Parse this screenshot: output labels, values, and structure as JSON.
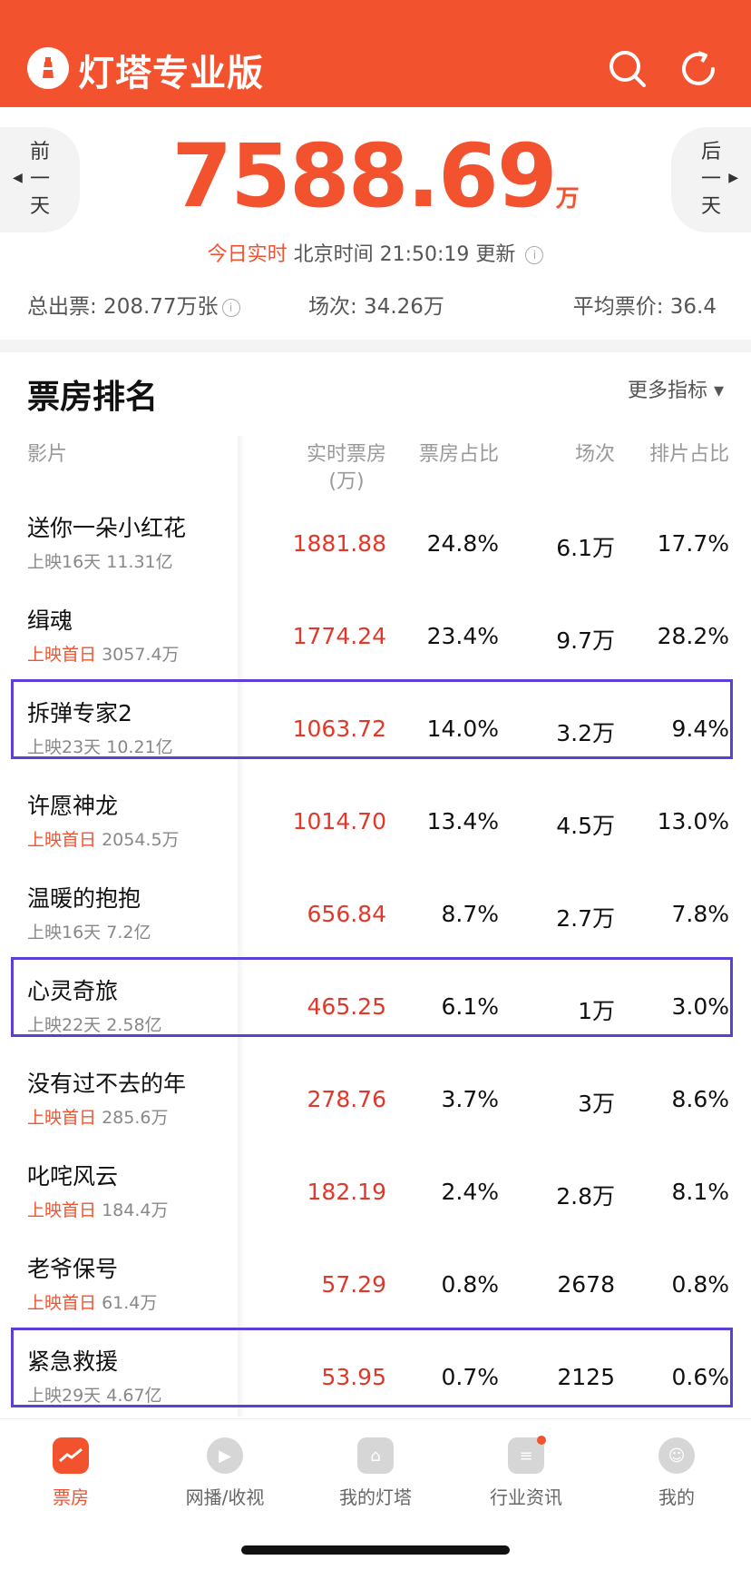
{
  "header": {
    "title": "灯塔专业版"
  },
  "summary": {
    "prev_day": [
      "前",
      "一",
      "天"
    ],
    "next_day": [
      "后",
      "一",
      "天"
    ],
    "total_value": "7588.69",
    "total_unit": "万",
    "realtime_label": "今日实时",
    "update_text": "北京时间 21:50:19 更新",
    "stats": {
      "tickets": "总出票: 208.77万张",
      "screenings": "场次: 34.26万",
      "avg_price": "平均票价: 36.4"
    }
  },
  "ranking": {
    "title": "票房排名",
    "more_metrics": "更多指标 ▾",
    "columns": {
      "film": "影片",
      "realtime_box_office": "实时票房",
      "realtime_unit": "(万)",
      "share": "票房占比",
      "screenings": "场次",
      "schedule_share": "排片占比"
    },
    "rows": [
      {
        "name": "送你一朵小红花",
        "tag": "",
        "days": "上映16天",
        "total": "11.31亿",
        "box": "1881.88",
        "share": "24.8%",
        "screenings": "6.1万",
        "schedule": "17.7%",
        "highlight": false
      },
      {
        "name": "缉魂",
        "tag": "上映首日",
        "days": "",
        "total": "3057.4万",
        "box": "1774.24",
        "share": "23.4%",
        "screenings": "9.7万",
        "schedule": "28.2%",
        "highlight": false
      },
      {
        "name": "拆弹专家2",
        "tag": "",
        "days": "上映23天",
        "total": "10.21亿",
        "box": "1063.72",
        "share": "14.0%",
        "screenings": "3.2万",
        "schedule": "9.4%",
        "highlight": true
      },
      {
        "name": "许愿神龙",
        "tag": "上映首日",
        "days": "",
        "total": "2054.5万",
        "box": "1014.70",
        "share": "13.4%",
        "screenings": "4.5万",
        "schedule": "13.0%",
        "highlight": false
      },
      {
        "name": "温暖的抱抱",
        "tag": "",
        "days": "上映16天",
        "total": "7.2亿",
        "box": "656.84",
        "share": "8.7%",
        "screenings": "2.7万",
        "schedule": "7.8%",
        "highlight": false
      },
      {
        "name": "心灵奇旅",
        "tag": "",
        "days": "上映22天",
        "total": "2.58亿",
        "box": "465.25",
        "share": "6.1%",
        "screenings": "1万",
        "schedule": "3.0%",
        "highlight": true
      },
      {
        "name": "没有过不去的年",
        "tag": "上映首日",
        "days": "",
        "total": "285.6万",
        "box": "278.76",
        "share": "3.7%",
        "screenings": "3万",
        "schedule": "8.6%",
        "highlight": false
      },
      {
        "name": "叱咤风云",
        "tag": "上映首日",
        "days": "",
        "total": "184.4万",
        "box": "182.19",
        "share": "2.4%",
        "screenings": "2.8万",
        "schedule": "8.1%",
        "highlight": false
      },
      {
        "name": "老爷保号",
        "tag": "上映首日",
        "days": "",
        "total": "61.4万",
        "box": "57.29",
        "share": "0.8%",
        "screenings": "2678",
        "schedule": "0.8%",
        "highlight": false
      },
      {
        "name": "紧急救援",
        "tag": "",
        "days": "上映29天",
        "total": "4.67亿",
        "box": "53.95",
        "share": "0.7%",
        "screenings": "2125",
        "schedule": "0.6%",
        "highlight": true
      }
    ]
  },
  "tabs": [
    {
      "label": "票房",
      "icon": "box-office-icon",
      "active": true
    },
    {
      "label": "网播/收视",
      "icon": "play-icon",
      "active": false
    },
    {
      "label": "我的灯塔",
      "icon": "lighthouse-icon",
      "active": false
    },
    {
      "label": "行业资讯",
      "icon": "news-icon",
      "active": false
    },
    {
      "label": "我的",
      "icon": "user-icon",
      "active": false
    }
  ],
  "colors": {
    "brand": "#f2522e",
    "highlight_box": "#5b3fd6",
    "value_red": "#e0392b"
  }
}
